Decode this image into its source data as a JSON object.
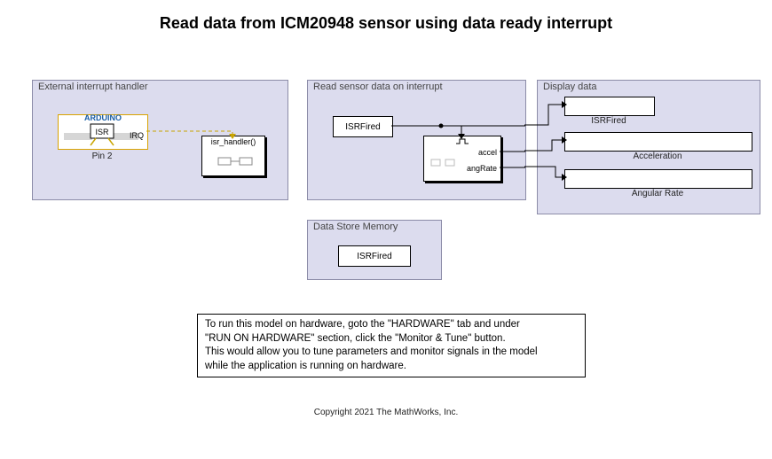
{
  "title": "Read data from ICM20948 sensor using data ready interrupt",
  "subsystems": {
    "ext_int": {
      "title": "External interrupt handler"
    },
    "read_sensor": {
      "title": "Read sensor data on interrupt"
    },
    "display": {
      "title": "Display data"
    },
    "dsm": {
      "title": "Data Store Memory"
    }
  },
  "blocks": {
    "arduino_tag": "ARDUINO",
    "isr_tag": "ISR",
    "irq_port": "IRQ",
    "pin_label": "Pin 2",
    "isr_handler": "isr_handler()",
    "isr_fired_src": "ISRFired",
    "sensor_out1": "accel",
    "sensor_out2": "angRate",
    "display1_label": "ISRFired",
    "display2_label": "Acceleration",
    "display3_label": "Angular Rate",
    "dsm_block": "ISRFired"
  },
  "note": {
    "line1": "To run this model on hardware, goto the \"HARDWARE\" tab and under",
    "line2": "\"RUN ON HARDWARE\" section, click the \"Monitor & Tune\" button.",
    "line3": "This would allow you to tune parameters and monitor signals in the model",
    "line4": "while the application is running on hardware."
  },
  "copyright": "Copyright 2021 The MathWorks, Inc."
}
